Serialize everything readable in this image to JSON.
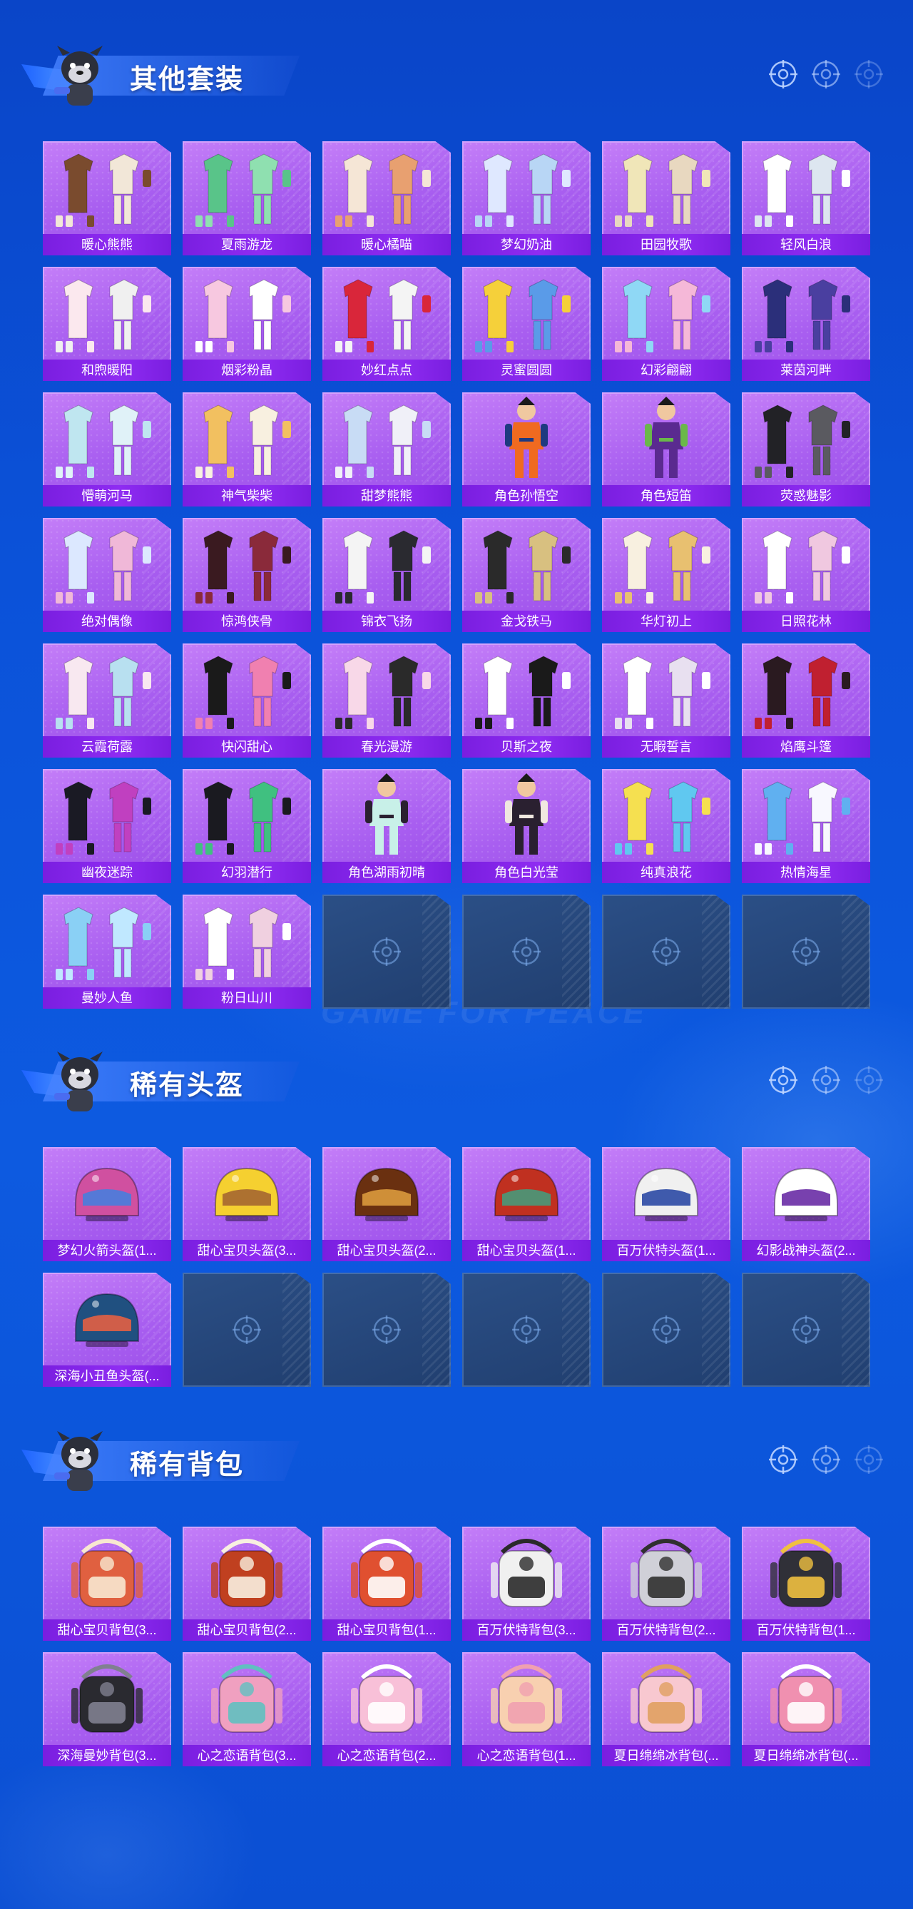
{
  "colors": {
    "background": "#0b52d9",
    "card_purple": "#a85ef0",
    "label_purple": "#7a1ee0",
    "empty_slot": "#233f6e",
    "title_text": "#ffffff"
  },
  "watermark": "GAME FOR PEACE",
  "sections": [
    {
      "title": "其他套装",
      "header_icons": [
        "crosshair-icon",
        "crosshair-icon",
        "crosshair-icon"
      ],
      "items": [
        {
          "label": "暖心熊熊",
          "kind": "outfit",
          "art": [
            "#7a4b2e",
            "#f2e7d8"
          ]
        },
        {
          "label": "夏雨游龙",
          "kind": "outfit",
          "art": [
            "#59c489",
            "#8fe0b0"
          ]
        },
        {
          "label": "暖心橘喵",
          "kind": "outfit",
          "art": [
            "#f5e6d6",
            "#e8a070"
          ]
        },
        {
          "label": "梦幻奶油",
          "kind": "outfit",
          "art": [
            "#dfe8ff",
            "#b8d6f5"
          ]
        },
        {
          "label": "田园牧歌",
          "kind": "outfit",
          "art": [
            "#f0e6b8",
            "#e8d8c0"
          ]
        },
        {
          "label": "轻风白浪",
          "kind": "outfit",
          "art": [
            "#ffffff",
            "#dde6f0"
          ]
        },
        {
          "label": "和煦暖阳",
          "kind": "outfit",
          "art": [
            "#fbe8ee",
            "#f0f0f0"
          ]
        },
        {
          "label": "烟彩粉晶",
          "kind": "outfit",
          "art": [
            "#f7c8e0",
            "#ffffff"
          ]
        },
        {
          "label": "妙红点点",
          "kind": "outfit",
          "art": [
            "#d9263a",
            "#f4f4f4"
          ]
        },
        {
          "label": "灵蜜圆圆",
          "kind": "outfit",
          "art": [
            "#f5d03a",
            "#5a9be8"
          ]
        },
        {
          "label": "幻彩翩翩",
          "kind": "outfit",
          "art": [
            "#8fd8f5",
            "#f5b8d8"
          ]
        },
        {
          "label": "莱茵河畔",
          "kind": "outfit",
          "art": [
            "#2b2f7a",
            "#4a3fa0"
          ]
        },
        {
          "label": "懵萌河马",
          "kind": "outfit",
          "art": [
            "#bfe6f0",
            "#e0f2f8"
          ]
        },
        {
          "label": "神气柴柴",
          "kind": "outfit",
          "art": [
            "#f2c060",
            "#f8f0e0"
          ]
        },
        {
          "label": "甜梦熊熊",
          "kind": "outfit",
          "art": [
            "#c8dcf5",
            "#f0f0f8"
          ]
        },
        {
          "label": "角色孙悟空",
          "kind": "character",
          "art": [
            "#f06a20",
            "#1e3a80"
          ]
        },
        {
          "label": "角色短笛",
          "kind": "character",
          "art": [
            "#5a2a90",
            "#6ab84a"
          ]
        },
        {
          "label": "荧惑魅影",
          "kind": "outfit",
          "art": [
            "#222226",
            "#5a5a60"
          ]
        },
        {
          "label": "绝对偶像",
          "kind": "outfit",
          "art": [
            "#dce8ff",
            "#f0b8d8"
          ]
        },
        {
          "label": "惊鸿侠骨",
          "kind": "outfit",
          "art": [
            "#3a1a20",
            "#8a2a3a"
          ]
        },
        {
          "label": "锦衣飞扬",
          "kind": "outfit",
          "art": [
            "#f4f4f4",
            "#2a2a30"
          ]
        },
        {
          "label": "金戈铁马",
          "kind": "outfit",
          "art": [
            "#2a2a2a",
            "#d8c080"
          ]
        },
        {
          "label": "华灯初上",
          "kind": "outfit",
          "art": [
            "#f8f0e0",
            "#e8c070"
          ]
        },
        {
          "label": "日照花林",
          "kind": "outfit",
          "art": [
            "#ffffff",
            "#f0c8e0"
          ]
        },
        {
          "label": "云霞荷露",
          "kind": "outfit",
          "art": [
            "#f8e8f0",
            "#b8e0f0"
          ]
        },
        {
          "label": "快闪甜心",
          "kind": "outfit",
          "art": [
            "#1a1a1a",
            "#f080b0"
          ]
        },
        {
          "label": "春光漫游",
          "kind": "outfit",
          "art": [
            "#f8d8e8",
            "#2a2a2a"
          ]
        },
        {
          "label": "贝斯之夜",
          "kind": "outfit",
          "art": [
            "#ffffff",
            "#1a1a1a"
          ]
        },
        {
          "label": "无暇誓言",
          "kind": "outfit",
          "art": [
            "#ffffff",
            "#e8e0f0"
          ]
        },
        {
          "label": "焰鹰斗篷",
          "kind": "outfit",
          "art": [
            "#2a1a20",
            "#c02030"
          ]
        },
        {
          "label": "幽夜迷踪",
          "kind": "outfit",
          "art": [
            "#1a1a24",
            "#c040c0"
          ]
        },
        {
          "label": "幻羽潜行",
          "kind": "outfit",
          "art": [
            "#1a1a20",
            "#40c080"
          ]
        },
        {
          "label": "角色湖雨初晴",
          "kind": "character",
          "art": [
            "#c8f0e8",
            "#2a2030"
          ]
        },
        {
          "label": "角色白光莹",
          "kind": "character",
          "art": [
            "#2a2030",
            "#f0e8e0"
          ]
        },
        {
          "label": "纯真浪花",
          "kind": "outfit",
          "art": [
            "#f5e050",
            "#60c8f0"
          ]
        },
        {
          "label": "热情海星",
          "kind": "outfit",
          "art": [
            "#60b0f0",
            "#f8f8ff"
          ]
        },
        {
          "label": "曼妙人鱼",
          "kind": "outfit",
          "art": [
            "#8ad0f5",
            "#c0e8ff"
          ]
        },
        {
          "label": "粉日山川",
          "kind": "outfit",
          "art": [
            "#ffffff",
            "#f0d0e0"
          ]
        },
        {
          "empty": true
        },
        {
          "empty": true
        },
        {
          "empty": true
        },
        {
          "empty": true
        }
      ]
    },
    {
      "title": "稀有头盔",
      "header_icons": [
        "crosshair-icon",
        "crosshair-icon",
        "crosshair-icon"
      ],
      "items": [
        {
          "label": "梦幻火箭头盔(1...",
          "kind": "helmet",
          "art": [
            "#d050a0",
            "#4080e0"
          ]
        },
        {
          "label": "甜心宝贝头盔(3...",
          "kind": "helmet",
          "art": [
            "#f5d030",
            "#a06030"
          ]
        },
        {
          "label": "甜心宝贝头盔(2...",
          "kind": "helmet",
          "art": [
            "#6a3010",
            "#e0a040"
          ]
        },
        {
          "label": "甜心宝贝头盔(1...",
          "kind": "helmet",
          "art": [
            "#c03020",
            "#40a080"
          ]
        },
        {
          "label": "百万伏特头盔(1...",
          "kind": "helmet",
          "art": [
            "#f0f0f0",
            "#2040a0"
          ]
        },
        {
          "label": "幻影战神头盔(2...",
          "kind": "helmet",
          "art": [
            "#ffffff",
            "#6020a0"
          ]
        },
        {
          "label": "深海小丑鱼头盔(...",
          "kind": "helmet",
          "art": [
            "#205080",
            "#f06040"
          ]
        },
        {
          "empty": true
        },
        {
          "empty": true
        },
        {
          "empty": true
        },
        {
          "empty": true
        },
        {
          "empty": true
        }
      ]
    },
    {
      "title": "稀有背包",
      "header_icons": [
        "crosshair-icon",
        "crosshair-icon",
        "crosshair-icon"
      ],
      "items": [
        {
          "label": "甜心宝贝背包(3...",
          "kind": "backpack",
          "art": [
            "#e06040",
            "#f8e8d0"
          ]
        },
        {
          "label": "甜心宝贝背包(2...",
          "kind": "backpack",
          "art": [
            "#c04020",
            "#f8f0e0"
          ]
        },
        {
          "label": "甜心宝贝背包(1...",
          "kind": "backpack",
          "art": [
            "#e05030",
            "#ffffff"
          ]
        },
        {
          "label": "百万伏特背包(3...",
          "kind": "backpack",
          "art": [
            "#f0f0f0",
            "#2a2a2a"
          ]
        },
        {
          "label": "百万伏特背包(2...",
          "kind": "backpack",
          "art": [
            "#d0d0d8",
            "#303030"
          ]
        },
        {
          "label": "百万伏特背包(1...",
          "kind": "backpack",
          "art": [
            "#303038",
            "#f0c040"
          ]
        },
        {
          "label": "深海曼妙背包(3...",
          "kind": "backpack",
          "art": [
            "#2a2a30",
            "#808090"
          ]
        },
        {
          "label": "心之恋语背包(3...",
          "kind": "backpack",
          "art": [
            "#f0a0c0",
            "#60c0c0"
          ]
        },
        {
          "label": "心之恋语背包(2...",
          "kind": "backpack",
          "art": [
            "#f8c0d8",
            "#ffffff"
          ]
        },
        {
          "label": "心之恋语背包(1...",
          "kind": "backpack",
          "art": [
            "#f8d0b0",
            "#f0a0b0"
          ]
        },
        {
          "label": "夏日绵绵冰背包(...",
          "kind": "backpack",
          "art": [
            "#f8c8d0",
            "#e0a060"
          ]
        },
        {
          "label": "夏日绵绵冰背包(...",
          "kind": "backpack",
          "art": [
            "#f090b0",
            "#ffffff"
          ]
        }
      ]
    }
  ]
}
